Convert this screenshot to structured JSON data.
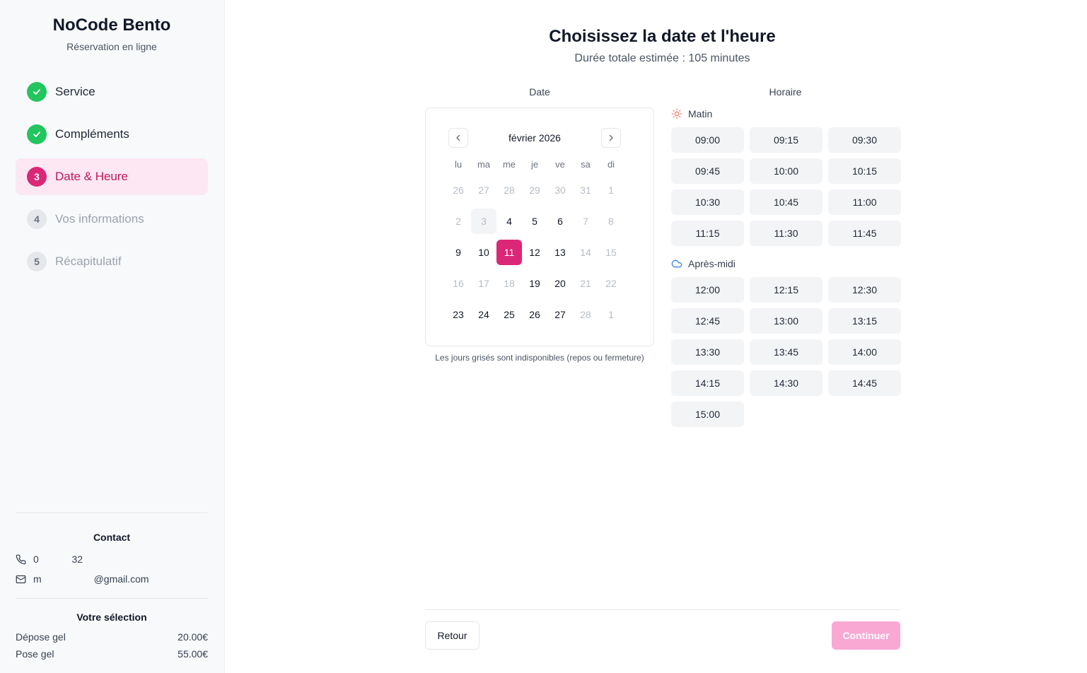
{
  "brand": {
    "title": "NoCode Bento",
    "subtitle": "Réservation en ligne"
  },
  "steps": [
    {
      "number": "1",
      "label": "Service",
      "state": "done"
    },
    {
      "number": "2",
      "label": "Compléments",
      "state": "done"
    },
    {
      "number": "3",
      "label": "Date & Heure",
      "state": "current"
    },
    {
      "number": "4",
      "label": "Vos informations",
      "state": "todo"
    },
    {
      "number": "5",
      "label": "Récapitulatif",
      "state": "todo"
    }
  ],
  "contact": {
    "heading": "Contact",
    "phone": "0            32",
    "email": "m                   @gmail.com"
  },
  "selection": {
    "heading": "Votre sélection",
    "items": [
      {
        "name": "Dépose gel",
        "price": "20.00€"
      },
      {
        "name": "Pose gel",
        "price": "55.00€"
      }
    ]
  },
  "main": {
    "title": "Choisissez la date et l'heure",
    "subtitle": "Durée totale estimée : 105 minutes",
    "date_heading": "Date",
    "time_heading": "Horaire"
  },
  "calendar": {
    "month": "février 2026",
    "weekdays": [
      "lu",
      "ma",
      "me",
      "je",
      "ve",
      "sa",
      "di"
    ],
    "note": "Les jours grisés sont indisponibles (repos ou fermeture)",
    "weeks": [
      [
        {
          "d": "26",
          "s": "dim"
        },
        {
          "d": "27",
          "s": "dim"
        },
        {
          "d": "28",
          "s": "dim"
        },
        {
          "d": "29",
          "s": "dim"
        },
        {
          "d": "30",
          "s": "dim"
        },
        {
          "d": "31",
          "s": "dim"
        },
        {
          "d": "1",
          "s": "dim"
        }
      ],
      [
        {
          "d": "2",
          "s": "dim"
        },
        {
          "d": "3",
          "s": "today"
        },
        {
          "d": "4",
          "s": "avail"
        },
        {
          "d": "5",
          "s": "avail"
        },
        {
          "d": "6",
          "s": "avail"
        },
        {
          "d": "7",
          "s": "dim"
        },
        {
          "d": "8",
          "s": "dim"
        }
      ],
      [
        {
          "d": "9",
          "s": "avail"
        },
        {
          "d": "10",
          "s": "avail"
        },
        {
          "d": "11",
          "s": "selected"
        },
        {
          "d": "12",
          "s": "avail"
        },
        {
          "d": "13",
          "s": "avail"
        },
        {
          "d": "14",
          "s": "dim"
        },
        {
          "d": "15",
          "s": "dim"
        }
      ],
      [
        {
          "d": "16",
          "s": "dim"
        },
        {
          "d": "17",
          "s": "dim"
        },
        {
          "d": "18",
          "s": "dim"
        },
        {
          "d": "19",
          "s": "avail"
        },
        {
          "d": "20",
          "s": "avail"
        },
        {
          "d": "21",
          "s": "dim"
        },
        {
          "d": "22",
          "s": "dim"
        }
      ],
      [
        {
          "d": "23",
          "s": "avail"
        },
        {
          "d": "24",
          "s": "avail"
        },
        {
          "d": "25",
          "s": "avail"
        },
        {
          "d": "26",
          "s": "avail"
        },
        {
          "d": "27",
          "s": "avail"
        },
        {
          "d": "28",
          "s": "dim"
        },
        {
          "d": "1",
          "s": "dim"
        }
      ]
    ]
  },
  "morning": {
    "label": "Matin",
    "slots": [
      "09:00",
      "09:15",
      "09:30",
      "09:45",
      "10:00",
      "10:15",
      "10:30",
      "10:45",
      "11:00",
      "11:15",
      "11:30",
      "11:45"
    ]
  },
  "afternoon": {
    "label": "Après-midi",
    "slots": [
      "12:00",
      "12:15",
      "12:30",
      "12:45",
      "13:00",
      "13:15",
      "13:30",
      "13:45",
      "14:00",
      "14:15",
      "14:30",
      "14:45",
      "15:00"
    ]
  },
  "actions": {
    "back": "Retour",
    "continue": "Continuer"
  },
  "colors": {
    "accent": "#db2777",
    "accent_light": "#fce7f3",
    "success": "#22c55e",
    "disabled_accent": "#f9a8d4"
  }
}
